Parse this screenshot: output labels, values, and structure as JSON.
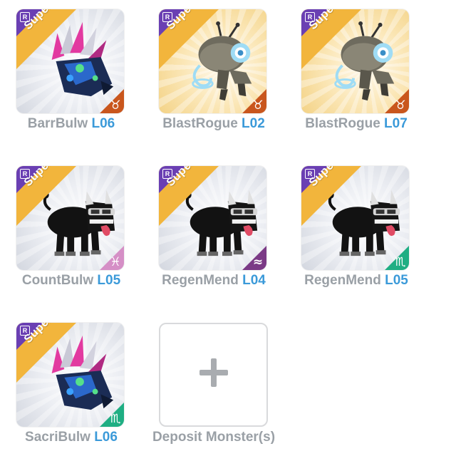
{
  "monsters": [
    {
      "name": "BarrBulw",
      "level": "L06",
      "rarity": "Super",
      "rank_badge": "R",
      "bg": "silver",
      "creature": "spiky-blue-beast",
      "sign": "taurus",
      "sign_glyph": "♉",
      "sign_color": "#c9561d"
    },
    {
      "name": "BlastRogue",
      "level": "L02",
      "rarity": "Super",
      "rank_badge": "R",
      "bg": "gold",
      "creature": "robot-crab",
      "sign": "taurus",
      "sign_glyph": "♉",
      "sign_color": "#c9561d"
    },
    {
      "name": "BlastRogue",
      "level": "L07",
      "rarity": "Super",
      "rank_badge": "R",
      "bg": "gold",
      "creature": "robot-crab",
      "sign": "taurus",
      "sign_glyph": "♉",
      "sign_color": "#c9561d"
    },
    {
      "name": "CountBulw",
      "level": "L05",
      "rarity": "Super",
      "rank_badge": "R",
      "bg": "silver",
      "creature": "black-bull",
      "sign": "pisces",
      "sign_glyph": "♓",
      "sign_color": "#d58fc6"
    },
    {
      "name": "RegenMend",
      "level": "L04",
      "rarity": "Super",
      "rank_badge": "R",
      "bg": "silver",
      "creature": "black-bull",
      "sign": "aquarius",
      "sign_glyph": "≈",
      "sign_color": "#7b3a86"
    },
    {
      "name": "RegenMend",
      "level": "L05",
      "rarity": "Super",
      "rank_badge": "R",
      "bg": "silver",
      "creature": "black-bull",
      "sign": "scorpio",
      "sign_glyph": "♏",
      "sign_color": "#1fae83"
    },
    {
      "name": "SacriBulw",
      "level": "L06",
      "rarity": "Super",
      "rank_badge": "R",
      "bg": "silver",
      "creature": "spiky-blue-beast",
      "sign": "scorpio",
      "sign_glyph": "♏",
      "sign_color": "#1fae83"
    }
  ],
  "deposit": {
    "label": "Deposit Monster(s)",
    "icon": "plus-icon"
  },
  "colors": {
    "name_text": "#9aa0a6",
    "level_text": "#3b9ad9",
    "super_banner": "#f2b53c",
    "rank_corner": "#6a3fb3"
  }
}
